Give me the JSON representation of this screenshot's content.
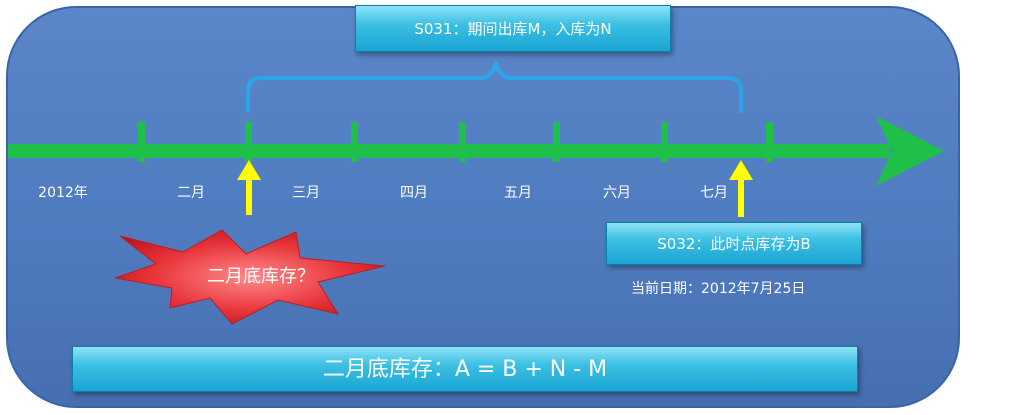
{
  "month_labels": [
    "2012年",
    "二月",
    "三月",
    "四月",
    "五月",
    "六月",
    "七月"
  ],
  "s031_label": "S031：期间出库M，入库为N",
  "s032_label": "S032：此时点库存为B",
  "current_date": "当前日期：2012年7月25日",
  "question_label": "二月底库存？",
  "formula_label": "二月底库存：A = B + N - M",
  "colors": {
    "panel": "#4f7cc0",
    "axis": "#1fc04a",
    "brace": "#2aa6e8",
    "marker_arrow": "#ffff00",
    "burst": "#e8353a",
    "box": "#3cc0e4"
  }
}
